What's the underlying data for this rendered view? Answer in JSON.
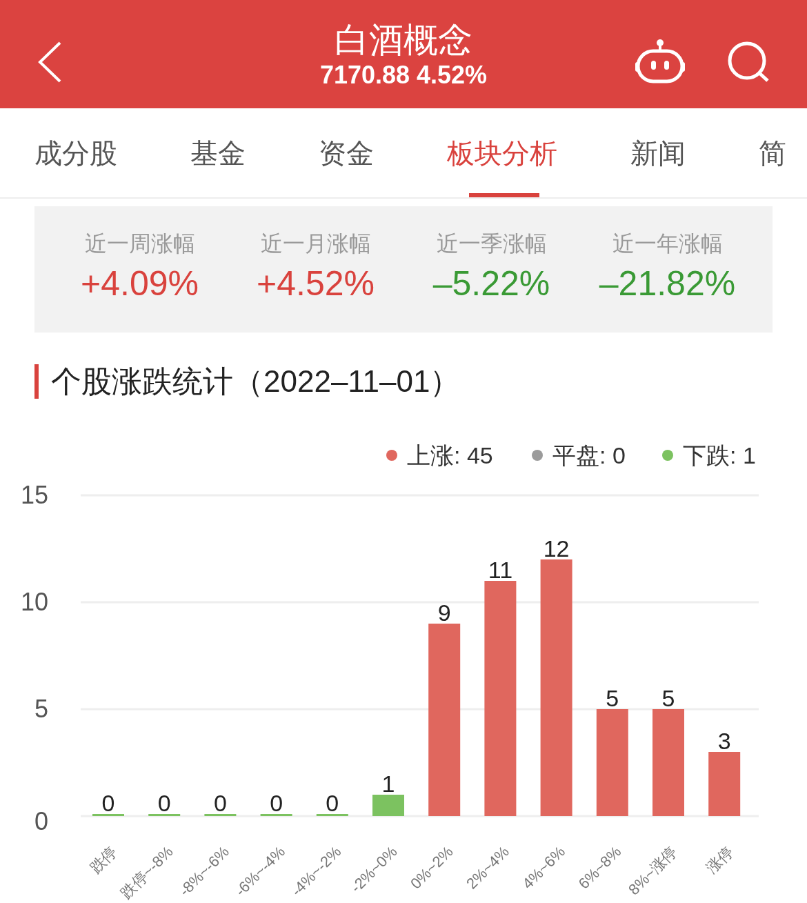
{
  "header": {
    "title": "白酒概念",
    "quote": "7170.88 4.52%"
  },
  "tabs": [
    {
      "label": "成分股",
      "selected": false
    },
    {
      "label": "基金",
      "selected": false
    },
    {
      "label": "资金",
      "selected": false
    },
    {
      "label": "板块分析",
      "selected": true
    },
    {
      "label": "新闻",
      "selected": false
    },
    {
      "label": "简",
      "selected": false
    }
  ],
  "stats": [
    {
      "label": "近一周涨幅",
      "value": "+4.09%",
      "kind": "up"
    },
    {
      "label": "近一月涨幅",
      "value": "+4.52%",
      "kind": "up"
    },
    {
      "label": "近一季涨幅",
      "value": "–5.22%",
      "kind": "down"
    },
    {
      "label": "近一年涨幅",
      "value": "–21.82%",
      "kind": "down"
    }
  ],
  "section_title": "个股涨跌统计（2022–11–01）",
  "legend": [
    {
      "label": "上涨: 45",
      "color": "#e0675e"
    },
    {
      "label": "平盘: 0",
      "color": "#9b9b9b"
    },
    {
      "label": "下跌: 1",
      "color": "#7cc260"
    }
  ],
  "chart_data": {
    "type": "bar",
    "categories": [
      "跌停",
      "跌停~-8%",
      "-8%~-6%",
      "-6%~-4%",
      "-4%~-2%",
      "-2%~0%",
      "0%~2%",
      "2%~4%",
      "4%~6%",
      "6%~8%",
      "8%~涨停",
      "涨停"
    ],
    "values": [
      0,
      0,
      0,
      0,
      0,
      1,
      9,
      11,
      12,
      5,
      5,
      3
    ],
    "colors": [
      "#7cc260",
      "#7cc260",
      "#7cc260",
      "#7cc260",
      "#7cc260",
      "#7cc260",
      "#e0675e",
      "#e0675e",
      "#e0675e",
      "#e0675e",
      "#e0675e",
      "#e0675e"
    ],
    "ylim": [
      0,
      15
    ],
    "yticks": [
      0,
      5,
      10,
      15
    ],
    "data_labels": true
  }
}
